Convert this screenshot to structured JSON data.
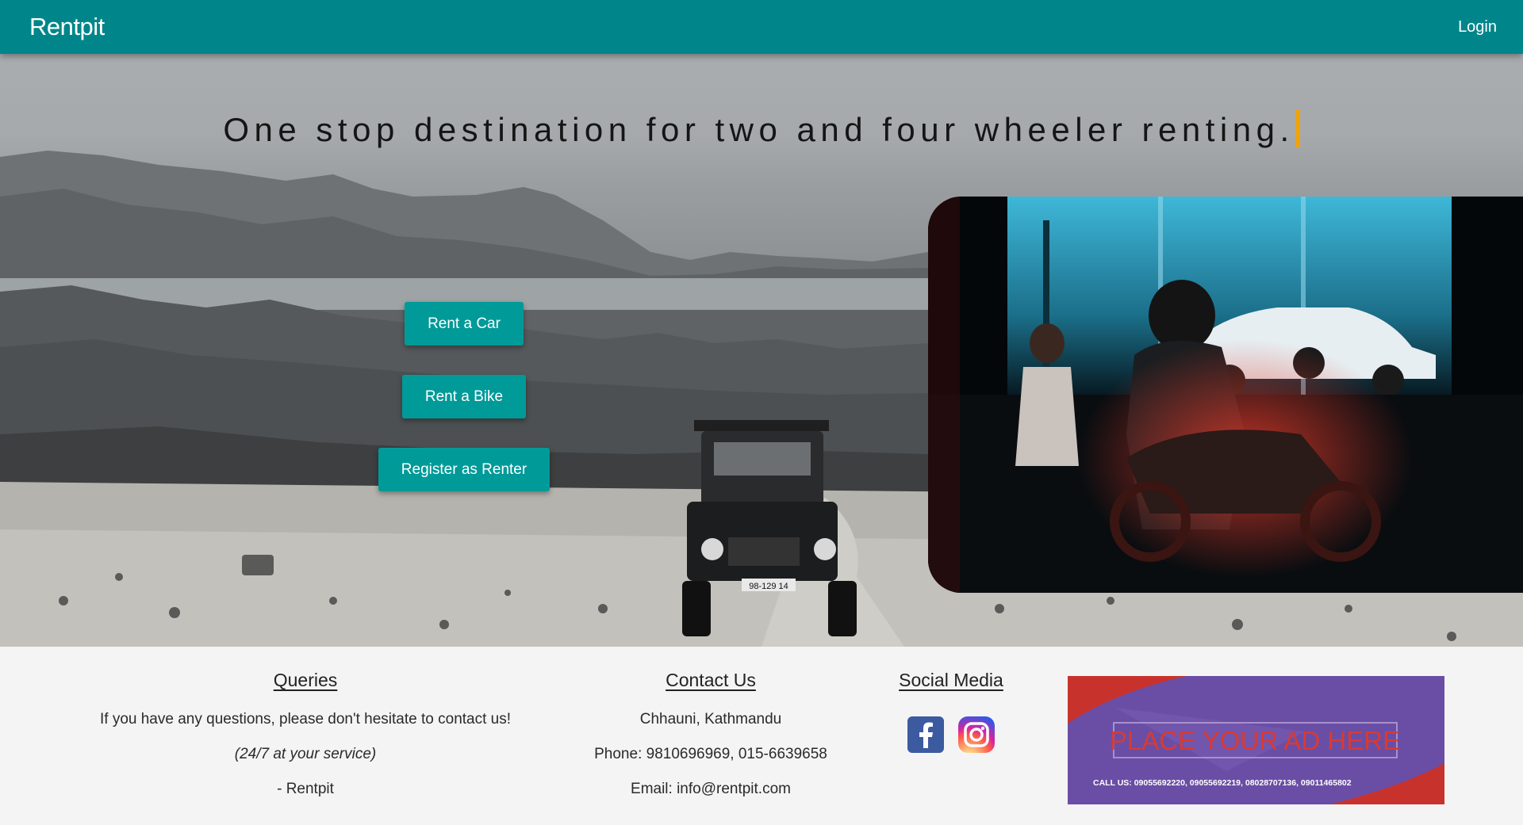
{
  "navbar": {
    "brand": "Rentpit",
    "login_label": "Login"
  },
  "hero": {
    "tagline": "One stop destination for two and four wheeler renting.",
    "buttons": {
      "rent_car": "Rent a Car",
      "rent_bike": "Rent a Bike",
      "register_renter": "Register as Renter"
    },
    "jeep_plate": "98-129 14"
  },
  "footer": {
    "queries": {
      "title": "Queries",
      "line1": "If you have any questions, please don't hesitate to contact us!",
      "line2": "(24/7 at your service)",
      "line3": "- Rentpit"
    },
    "contact": {
      "title": "Contact Us",
      "address": "Chhauni, Kathmandu",
      "phone": "Phone: 9810696969, 015-6639658",
      "email": "Email: info@rentpit.com"
    },
    "social": {
      "title": "Social Media",
      "icons": [
        "facebook-icon",
        "instagram-icon"
      ]
    },
    "ad": {
      "headline": "PLACE YOUR AD HERE",
      "call_line": "CALL US:  09055692220, 09055692219, 08028707136, 09011465802"
    }
  },
  "colors": {
    "nav": "#00868a",
    "button": "#009a98",
    "caret": "#f5a200"
  }
}
